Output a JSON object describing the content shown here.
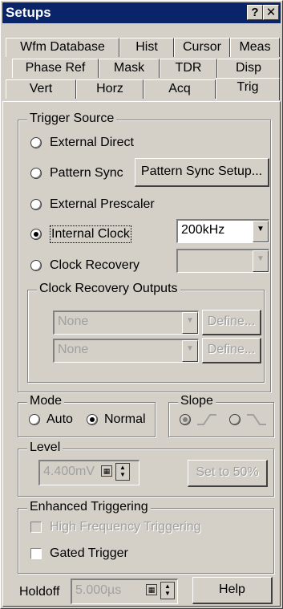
{
  "window": {
    "title": "Setups",
    "help_btn": "?",
    "close_btn": "✕"
  },
  "tabs": {
    "row1": [
      "Wfm Database",
      "Hist",
      "Cursor",
      "Meas"
    ],
    "row2": [
      "Phase Ref",
      "Mask",
      "TDR",
      "Disp"
    ],
    "row3": [
      "Vert",
      "Horz",
      "Acq",
      "Trig"
    ],
    "active": "Trig"
  },
  "trigger_source": {
    "label": "Trigger Source",
    "options": {
      "external_direct": "External Direct",
      "pattern_sync": "Pattern Sync",
      "external_prescaler": "External Prescaler",
      "internal_clock": "Internal Clock",
      "clock_recovery": "Clock Recovery"
    },
    "selected": "Internal Clock",
    "pattern_sync_setup_button": "Pattern Sync Setup...",
    "internal_clock_rate": "200kHz",
    "clock_recovery_value": ""
  },
  "clock_recovery_outputs": {
    "label": "Clock Recovery Outputs",
    "output1": "None",
    "output2": "None",
    "define1": "Define...",
    "define2": "Define..."
  },
  "mode": {
    "label": "Mode",
    "auto": "Auto",
    "normal": "Normal",
    "selected": "Normal"
  },
  "slope": {
    "label": "Slope",
    "selected": "rising"
  },
  "level": {
    "label": "Level",
    "value": "4.400mV",
    "set50": "Set to 50%"
  },
  "enhanced": {
    "label": "Enhanced Triggering",
    "high_freq": "High Frequency Triggering",
    "gated": "Gated Trigger"
  },
  "holdoff": {
    "label": "Holdoff",
    "value": "5.000µs"
  },
  "help_button": "Help"
}
